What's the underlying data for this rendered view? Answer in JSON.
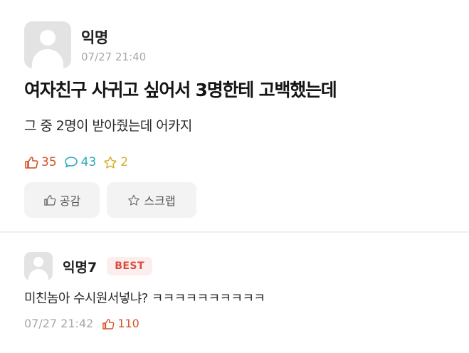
{
  "post": {
    "author": "익명",
    "time": "07/27 21:40",
    "title": "여자친구 사귀고 싶어서 3명한테 고백했는데",
    "body": "그 중 2명이 받아줬는데 어카지",
    "stats": {
      "likes": "35",
      "comments": "43",
      "scraps": "2"
    },
    "actions": {
      "like_label": "공감",
      "scrap_label": "스크랩"
    }
  },
  "comment": {
    "author": "익명7",
    "badge": "BEST",
    "text": "미친놈아 수시원서넣냐? ㅋㅋㅋㅋㅋㅋㅋㅋㅋㅋ",
    "time": "07/27 21:42",
    "likes": "110"
  },
  "colors": {
    "like": "#d4532b",
    "comment": "#2ba9bf",
    "scrap": "#d1b231",
    "best_badge": "#d94b3f"
  },
  "icons": {
    "like": "thumbs-up-icon",
    "comment": "speech-bubble-icon",
    "scrap": "star-icon",
    "avatar": "default-avatar-icon"
  }
}
